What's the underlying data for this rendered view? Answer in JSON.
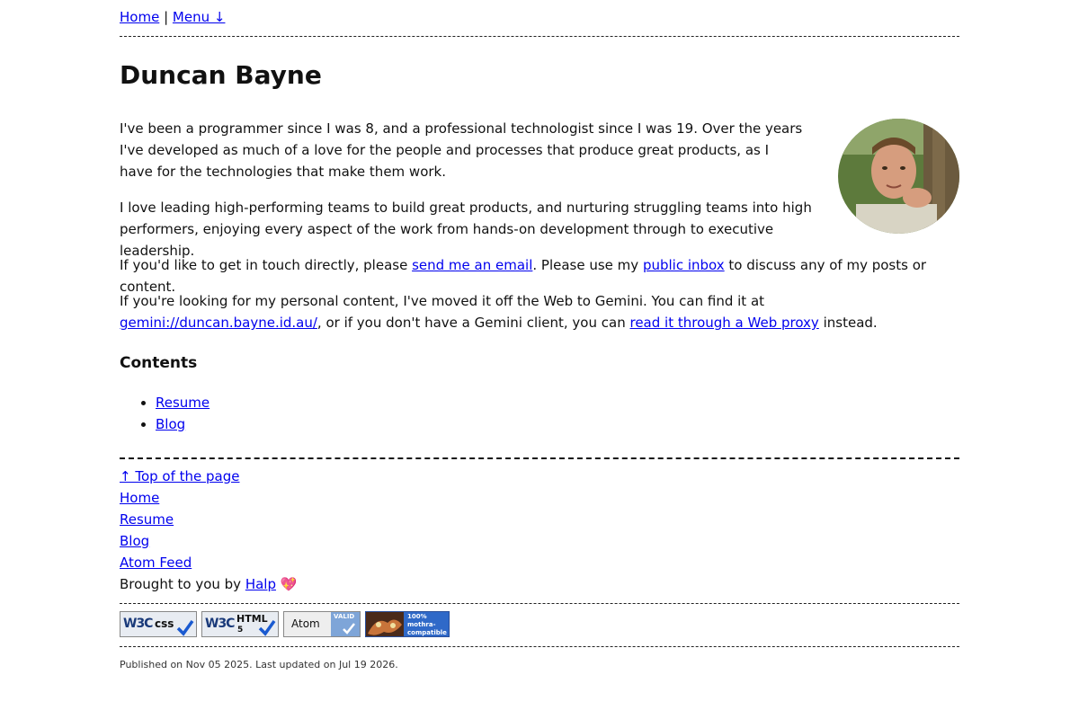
{
  "nav": {
    "home": "Home",
    "separator": "|",
    "menu": "Menu ↓"
  },
  "page_title": "Duncan Bayne",
  "intro": {
    "p1": "I've been a programmer since I was 8, and a professional technologist since I was 19. Over the years I've developed as much of a love for the people and processes that produce great products, as I have for the technologies that make them work.",
    "p2": "I love leading high-performing teams to build great products, and nurturing struggling teams into high performers, enjoying every aspect of the work from hands-on development through to executive leadership.",
    "p3": {
      "before": "If you'd like to get in touch directly, please ",
      "email_link": "send me an email",
      "middle": ". Please use my ",
      "inbox_link": "public inbox",
      "after": " to discuss any of my posts or content."
    },
    "p4": {
      "before": "If you're looking for my personal content, I've moved it off the Web to Gemini. You can find it at ",
      "gemini_link": "gemini://duncan.bayne.id.au/",
      "middle": ", or if you don't have a Gemini client, you can ",
      "proxy_link": "read it through a Web proxy",
      "after": " instead."
    }
  },
  "contents": {
    "heading": "Contents",
    "items": [
      "Resume",
      "Blog"
    ]
  },
  "footer": {
    "top_link": "↑ Top of the page",
    "home": "Home",
    "resume": "Resume",
    "blog": "Blog",
    "atom": "Atom Feed",
    "brought_text": "Brought to you by ",
    "halp_link": "Halp",
    "heart": "💖"
  },
  "badges": {
    "css": {
      "w3c": "W3C",
      "label": "css"
    },
    "html": {
      "w3c": "W3C",
      "label": "HTML",
      "version": "5"
    },
    "atom": {
      "label": "Atom",
      "valid": "VALID"
    },
    "mothra": {
      "line1": "100%",
      "line2": "mothra-",
      "line3": "compatible"
    }
  },
  "meta": {
    "published": "Published on Nov 05 2025. Last updated on Jul 19 2026."
  },
  "colors": {
    "link": "#0000ee",
    "badge_blue": "#3a6fd0"
  }
}
